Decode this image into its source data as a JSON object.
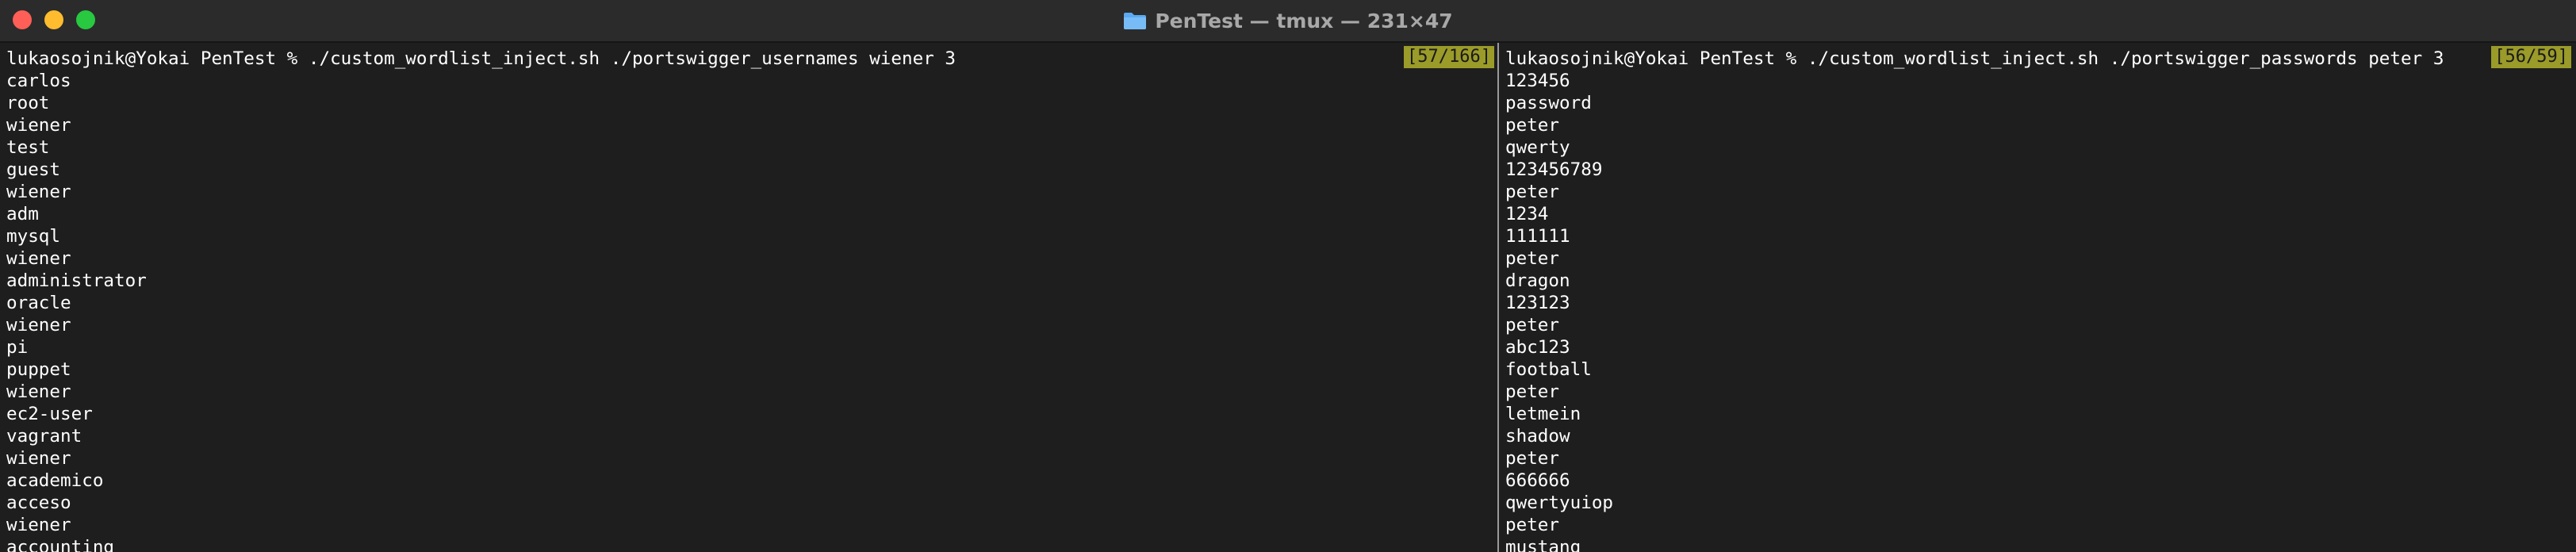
{
  "window": {
    "title": "PenTest — tmux — 231×47",
    "icon": "folder-icon",
    "traffic_lights": [
      "close",
      "minimize",
      "maximize"
    ]
  },
  "panes": [
    {
      "badge": "[57/166]",
      "command": "lukaosojnik@Yokai PenTest % ./custom_wordlist_inject.sh ./portswigger_usernames wiener 3",
      "output": [
        "carlos",
        "root",
        "wiener",
        "test",
        "guest",
        "wiener",
        "adm",
        "mysql",
        "wiener",
        "administrator",
        "oracle",
        "wiener",
        "pi",
        "puppet",
        "wiener",
        "ec2-user",
        "vagrant",
        "wiener",
        "academico",
        "acceso",
        "wiener",
        "accounting"
      ]
    },
    {
      "badge": "[56/59]",
      "command": "lukaosojnik@Yokai PenTest % ./custom_wordlist_inject.sh ./portswigger_passwords peter 3",
      "output": [
        "123456",
        "password",
        "peter",
        "qwerty",
        "123456789",
        "peter",
        "1234",
        "111111",
        "peter",
        "dragon",
        "123123",
        "peter",
        "abc123",
        "football",
        "peter",
        "letmein",
        "shadow",
        "peter",
        "666666",
        "qwertyuiop",
        "peter",
        "mustang"
      ]
    }
  ],
  "colors": {
    "background": "#1e1e1e",
    "titlebar": "#2b2b2b",
    "text": "#ffffff",
    "badge": "#9a9b29",
    "title_text": "#a8a8a8"
  }
}
